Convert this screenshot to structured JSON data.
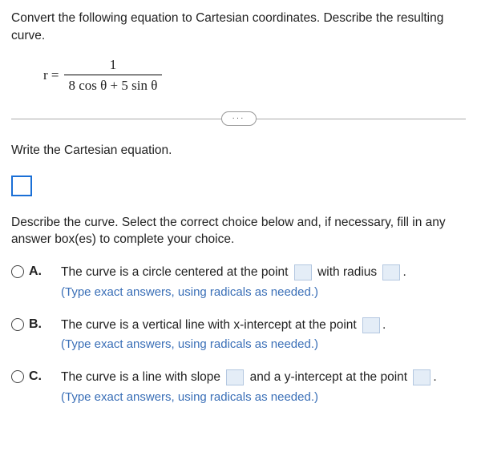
{
  "prompt": "Convert the following equation to Cartesian coordinates. Describe the resulting curve.",
  "equation": {
    "lhs": "r =",
    "numerator": "1",
    "denominator": "8 cos θ + 5 sin θ"
  },
  "expander": "···",
  "section1": "Write the Cartesian equation.",
  "section2": "Describe the curve. Select the correct choice below and, if necessary, fill in any answer box(es) to complete your choice.",
  "choices": {
    "a": {
      "label": "A.",
      "pre": "The curve is a circle centered at the point",
      "mid": "with radius",
      "post": ".",
      "hint": "(Type exact answers, using radicals as needed.)"
    },
    "b": {
      "label": "B.",
      "pre": "The curve is a vertical line with x-intercept at the point",
      "post": ".",
      "hint": "(Type exact answers, using radicals as needed.)"
    },
    "c": {
      "label": "C.",
      "pre": "The curve is a line with slope",
      "mid": "and a y-intercept at the point",
      "post": ".",
      "hint": "(Type exact answers, using radicals as needed.)"
    }
  }
}
